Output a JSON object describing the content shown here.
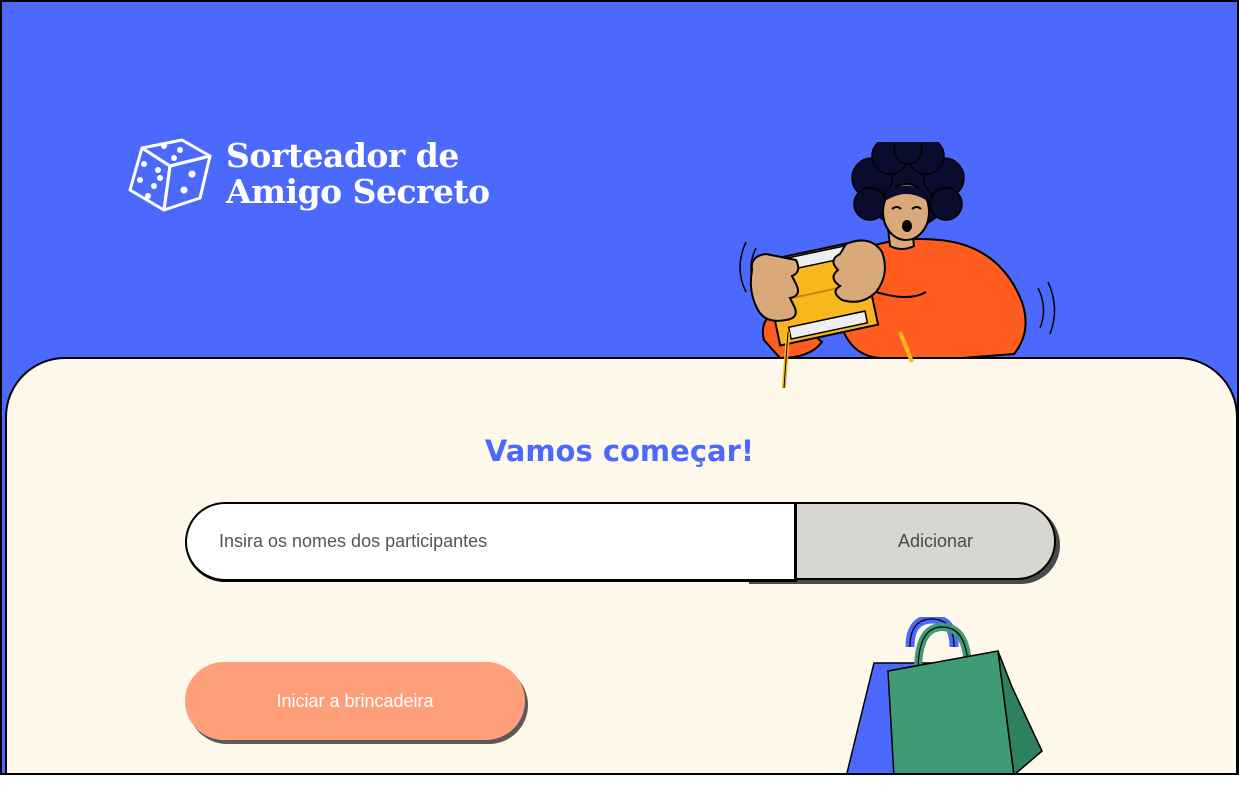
{
  "header": {
    "logo_line1": "Sorteador de",
    "logo_line2": "Amigo Secreto"
  },
  "main": {
    "title": "Vamos começar!",
    "name_input": {
      "placeholder": "Insira os nomes dos participantes",
      "value": ""
    },
    "add_button_label": "Adicionar",
    "start_button_label": "Iniciar a brincadeira"
  },
  "colors": {
    "header_bg": "#4b69fd",
    "card_bg": "#fff9eb",
    "accent_blue": "#4b69fd",
    "start_button": "#fe9f7a",
    "add_button": "#d8d6d1"
  },
  "icons": [
    "dice-icon",
    "person-with-gift-illustration",
    "shopping-bags-illustration"
  ]
}
